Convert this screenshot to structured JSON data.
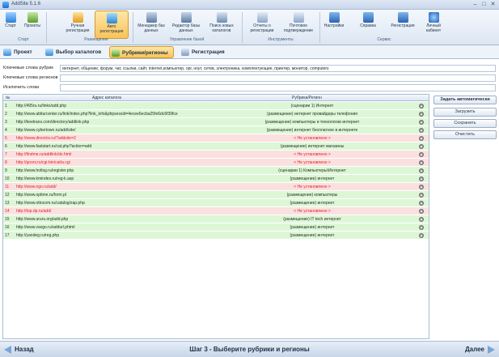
{
  "window": {
    "title": "AddSite 5.1.6",
    "minimize": "–",
    "maximize": "□",
    "close": "✕"
  },
  "ribbon": {
    "groups": [
      {
        "label": "Старт"
      },
      {
        "label": "Размещение"
      },
      {
        "label": "Управление базой"
      },
      {
        "label": "Инструменты"
      },
      {
        "label": "Сервис"
      }
    ],
    "buttons": [
      {
        "label": "Старт",
        "icon": "home-icon"
      },
      {
        "label": "Проекты",
        "icon": "projects-icon"
      },
      {
        "label": "Ручная регистрация",
        "icon": "manual-registration-icon"
      },
      {
        "label": "Авто регистрация",
        "icon": "auto-registration-icon",
        "active": true
      },
      {
        "label": "Менеджер баз данных",
        "icon": "db-manager-icon"
      },
      {
        "label": "Редактор базы данных",
        "icon": "db-editor-icon"
      },
      {
        "label": "Поиск новых каталогов",
        "icon": "search-catalogs-icon"
      },
      {
        "label": "Отчеты о регистрации",
        "icon": "reports-icon"
      },
      {
        "label": "Почтовое подтверждение",
        "icon": "mail-confirm-icon"
      },
      {
        "label": "Настройки",
        "icon": "settings-icon"
      },
      {
        "label": "Справка",
        "icon": "help-icon"
      },
      {
        "label": "Регистрация",
        "icon": "key-icon"
      },
      {
        "label": "Личный кабинет",
        "icon": "account-icon"
      }
    ]
  },
  "tabs": [
    {
      "label": "Проект",
      "icon": "project-tab-icon"
    },
    {
      "label": "Выбор каталогов",
      "icon": "catalog-select-icon"
    },
    {
      "label": "Рубрики/регионы",
      "icon": "rubrics-icon",
      "active": true
    },
    {
      "label": "Регистрация",
      "icon": "registration-tab-icon"
    }
  ],
  "keywords": {
    "rubrics_label": "Ключевые слова рубрик",
    "rubrics_value": "интернет, общение, форум, чат, ссылки, сайт, internet,компьютер, орг, ноут, сетев, электроника, комплектующие, принтер, монитор, computers",
    "regions_label": "Ключевые слова регионов",
    "regions_value": "",
    "exclude_label": "Исключить слова",
    "exclude_value": ""
  },
  "table": {
    "columns": {
      "num": "№",
      "url": "Адрес каталога",
      "rubric": "Рубрика/Регион"
    },
    "rows": [
      {
        "num": "1",
        "url": "http://495ru.ru/links/add.php",
        "rubric": "(сценарии 1) Интернет",
        "status": "ok"
      },
      {
        "num": "2",
        "url": "http://www.abiturcenter.ru/link/index.php?link_info&phpsessid=4ecee6ecba25fe6dc6f39fce6b4e06",
        "rubric": "(размещение) интернет провайдеры телефония",
        "status": "ok"
      },
      {
        "num": "3",
        "url": "http://beetrans.com/directory/addlink.php",
        "rubric": "(размещение) компьютеры и технологии интернет",
        "status": "ok"
      },
      {
        "num": "4",
        "url": "http://www.cybertown.ru/add/site/",
        "rubric": "(размещение) интернет бесплатное в интернете",
        "status": "ok"
      },
      {
        "num": "5",
        "url": "http://www.directrix.ru/?addsite=2",
        "rubric": "< Не установлено >",
        "status": "bad"
      },
      {
        "num": "6",
        "url": "http://www.faststart.ru/cat.php?action=add",
        "rubric": "(размещение) интернет магазины",
        "status": "ok"
      },
      {
        "num": "7",
        "url": "http://findme.ru/addlink/do.html",
        "rubric": "< Не установлено >",
        "status": "bad"
      },
      {
        "num": "8",
        "url": "http://gooni.ru/cgi-bin/cat/a.cgi",
        "rubric": "< Не установлено >",
        "status": "bad"
      },
      {
        "num": "9",
        "url": "http://www.hotlsg.ru/register.php",
        "rubric": "(сценарии 1) Компьютеры\\Интернет",
        "status": "ok"
      },
      {
        "num": "10",
        "url": "http://www.kmindex.ru/reg-k.asp",
        "rubric": "(размещение) интернет",
        "status": "ok"
      },
      {
        "num": "11",
        "url": "http://www.ngo.ru/add/",
        "rubric": "< Не установлено >",
        "status": "bad"
      },
      {
        "num": "12",
        "url": "http://www.optime.ru/form.pl",
        "rubric": "(размещение) компьютеры",
        "status": "ok"
      },
      {
        "num": "13",
        "url": "http://www.ottocom.ru/catalog/zap.php",
        "rubric": "(размещение) интернет",
        "status": "ok"
      },
      {
        "num": "14",
        "url": "http://top.dp.ru/add/",
        "rubric": "< Не установлено >",
        "status": "bad"
      },
      {
        "num": "15",
        "url": "http://www.ururu.org/add.php",
        "rubric": "(размещение) IT tech интернет",
        "status": "ok"
      },
      {
        "num": "16",
        "url": "http://www.vsego.ru/addurl.phtml",
        "rubric": "(размещение) интернет",
        "status": "ok"
      },
      {
        "num": "17",
        "url": "http://yandeg.ru/reg.php",
        "rubric": "(размещение) интернет",
        "status": "ok"
      }
    ]
  },
  "side_buttons": {
    "auto": "Задать автоматически",
    "load": "Загрузить",
    "save": "Сохранить",
    "clear": "Очистить"
  },
  "footer": {
    "back": "Назад",
    "step": "Шаг 3 - Выберите рубрики и регионы",
    "next": "Далее"
  },
  "colors": {
    "ok_row": "#ddf7d6",
    "bad_row": "#fbe0e0",
    "bad_text": "#e0201f",
    "active_tab": "#f8c35a"
  }
}
